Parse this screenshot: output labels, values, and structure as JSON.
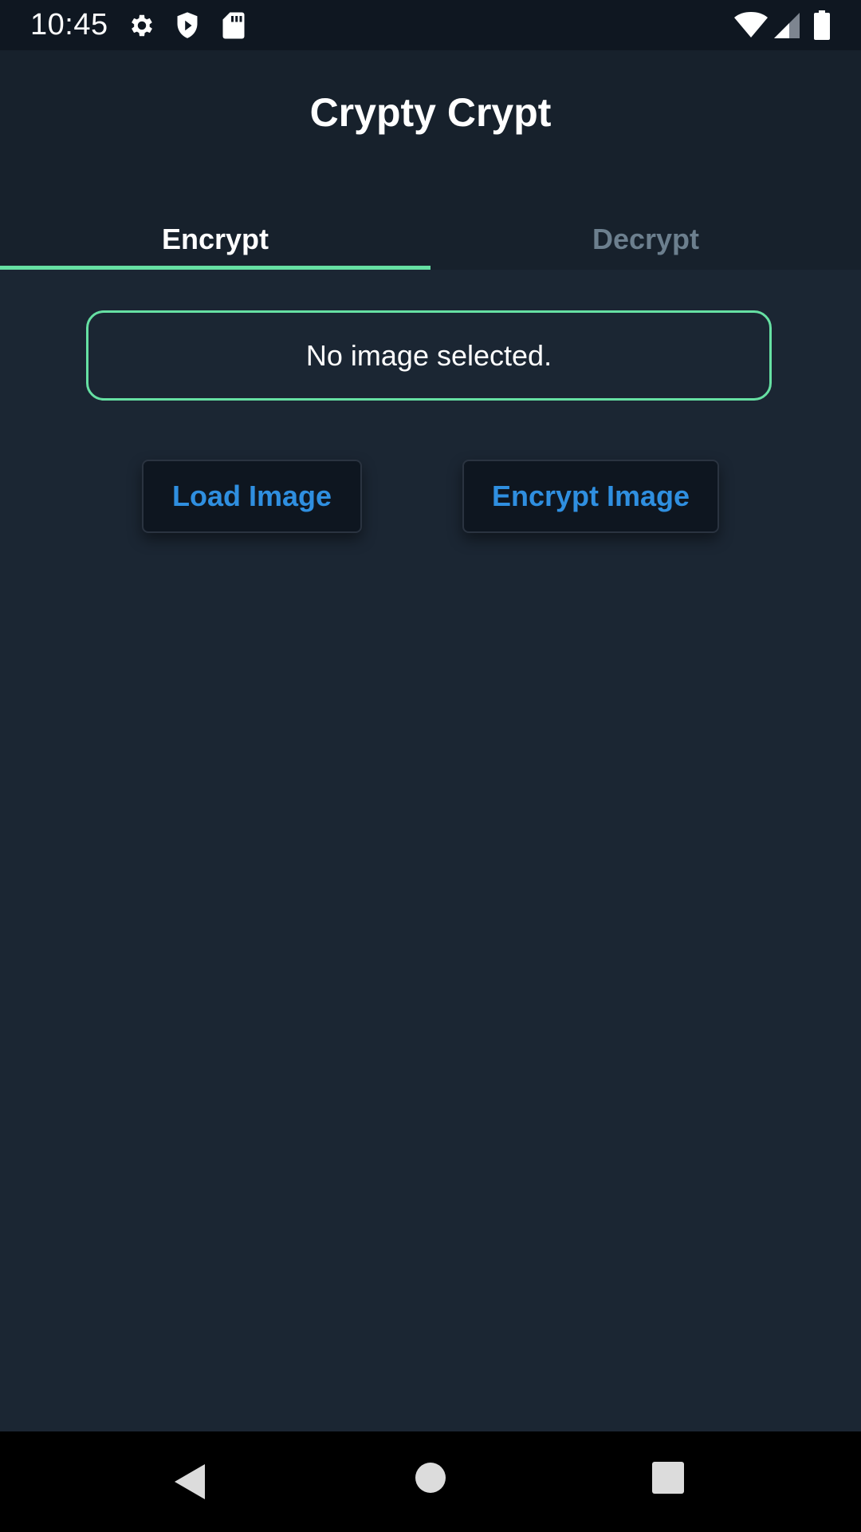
{
  "status_bar": {
    "time": "10:45",
    "icons": [
      "gear-icon",
      "shield-icon",
      "sd-card-icon",
      "wifi-icon",
      "signal-icon",
      "battery-icon"
    ]
  },
  "app_bar": {
    "title": "Crypty Crypt",
    "tabs": [
      {
        "label": "Encrypt",
        "selected": true
      },
      {
        "label": "Decrypt",
        "selected": false
      }
    ]
  },
  "main": {
    "status_message": "No image selected.",
    "load_button_label": "Load Image",
    "encrypt_button_label": "Encrypt Image"
  },
  "colors": {
    "accent": "#66e0a3",
    "button_text": "#2f8fe0",
    "background": "#1b2633"
  },
  "nav_bar": {
    "icons": [
      "back-icon",
      "home-icon",
      "recents-icon"
    ]
  }
}
